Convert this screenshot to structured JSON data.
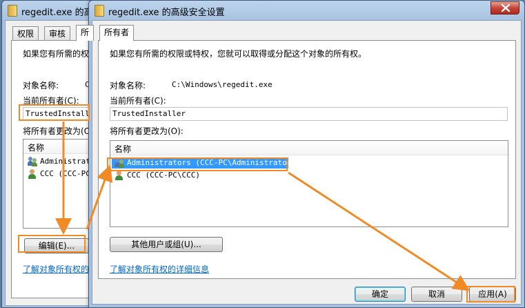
{
  "back_window": {
    "title": "regedit.exe 的高级",
    "tabs": [
      "权限",
      "审核",
      "所"
    ],
    "intro": "如果您有所需的权",
    "object_name_label": "对象名称:",
    "object_name_value": "C",
    "current_owner_label": "当前所有者(C):",
    "current_owner_value": "TrustedInstaller",
    "change_owner_label": "将所有者更改为(O",
    "list_header": "名称",
    "list_rows": [
      "Administrato",
      "CCC (CCC-PC\\C"
    ],
    "edit_button": "编辑(E)...",
    "help_link": "了解对象所有权的"
  },
  "front_window": {
    "title": "regedit.exe 的高级安全设置",
    "tab": "所有者",
    "intro": "如果您有所需的权限或特权，您就可以取得或分配这个对象的所有权。",
    "object_name_label": "对象名称:",
    "object_name_value": "C:\\Windows\\regedit.exe",
    "current_owner_label": "当前所有者(C):",
    "current_owner_value": "TrustedInstaller",
    "change_owner_label": "将所有者更改为(O):",
    "list_header": "名称",
    "list_rows": [
      {
        "label": "Administrators (CCC-PC\\Administrators)",
        "icon": "group-icon",
        "selected": true
      },
      {
        "label": "CCC (CCC-PC\\CCC)",
        "icon": "user-icon",
        "selected": false
      }
    ],
    "other_users_button": "其他用户或组(U)...",
    "help_link": "了解对象所有权的详细信息",
    "ok_button": "确定",
    "cancel_button": "取消",
    "apply_button": "应用(A)"
  },
  "colors": {
    "annotation": "#f08a24",
    "selection": "#3399ff",
    "link": "#0066cc"
  }
}
